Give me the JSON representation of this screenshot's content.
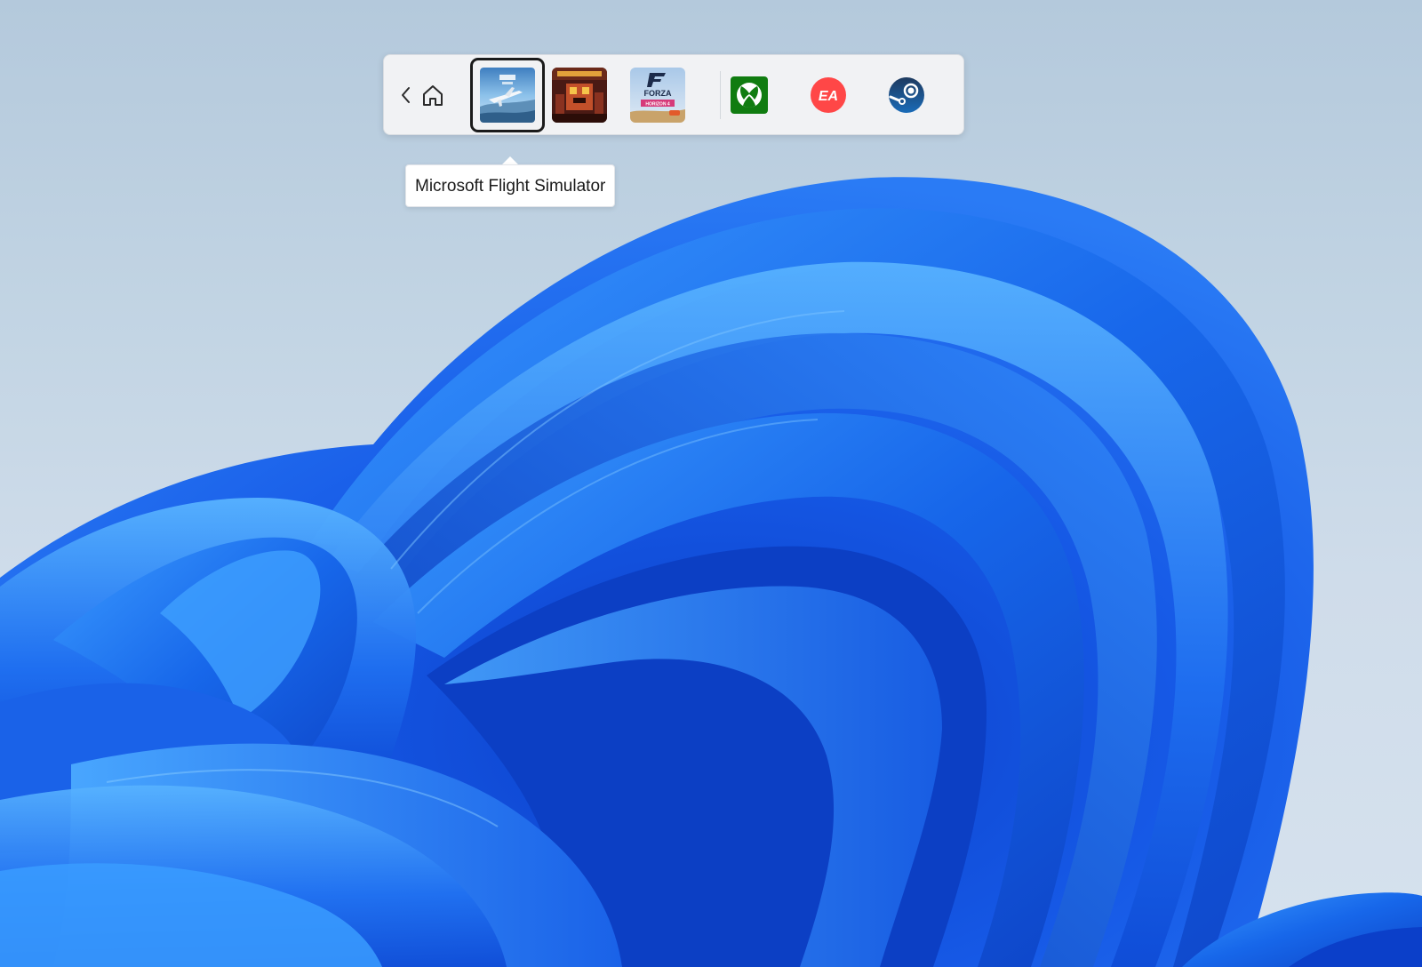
{
  "game_bar": {
    "back_icon": "chevron-left-icon",
    "home_icon": "home-icon",
    "games": [
      {
        "name": "Microsoft Flight Simulator",
        "selected": true
      },
      {
        "name": "Minecraft Dungeons",
        "selected": false
      },
      {
        "name": "Forza Horizon 4",
        "selected": false
      }
    ],
    "launchers": [
      {
        "name": "Xbox",
        "icon": "xbox-icon",
        "color": "#107c10"
      },
      {
        "name": "EA",
        "icon": "ea-icon",
        "color": "#ff4747"
      },
      {
        "name": "Steam",
        "icon": "steam-icon",
        "color": "#1b2838"
      }
    ]
  },
  "tooltip": {
    "text": "Microsoft Flight Simulator"
  },
  "tile_art": {
    "forza_line1": "FORZA",
    "forza_line2": "HORIZON 4",
    "ea_label": "EA"
  },
  "colors": {
    "wallpaper_blue": "#1a5fe0",
    "wallpaper_light": "#4aa3ff",
    "bar_background": "#f1f2f4",
    "selection_border": "#1b1b1b"
  }
}
